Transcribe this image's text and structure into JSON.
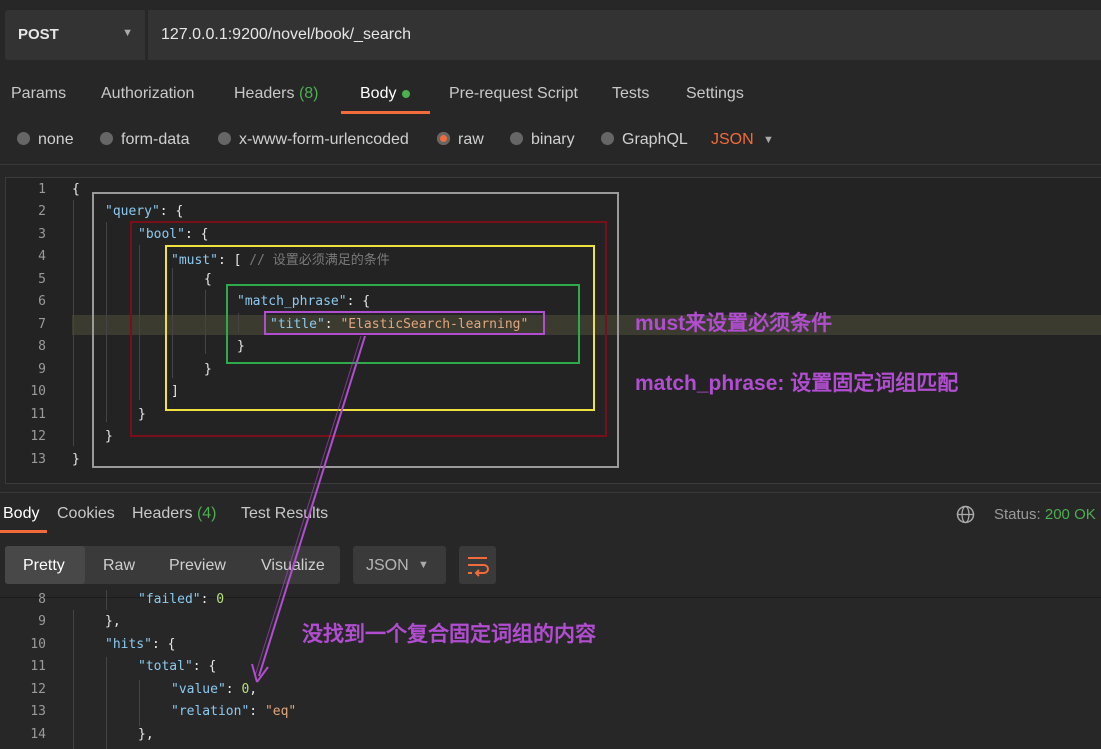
{
  "request": {
    "method": "POST",
    "url": "127.0.0.1:9200/novel/book/_search"
  },
  "request_tabs": [
    {
      "label": "Params"
    },
    {
      "label": "Authorization"
    },
    {
      "label": "Headers",
      "count": "(8)"
    },
    {
      "label": "Body"
    },
    {
      "label": "Pre-request Script"
    },
    {
      "label": "Tests"
    },
    {
      "label": "Settings"
    }
  ],
  "body_types": [
    "none",
    "form-data",
    "x-www-form-urlencoded",
    "raw",
    "binary",
    "GraphQL"
  ],
  "body_language": "JSON",
  "editor": {
    "line_numbers": [
      "1",
      "2",
      "3",
      "4",
      "5",
      "6",
      "7",
      "8",
      "9",
      "10",
      "11",
      "12",
      "13"
    ],
    "lines": [
      "{",
      "  \"query\": {",
      "    \"bool\": {",
      "      \"must\": [ // 设置必须满足的条件",
      "        {",
      "          \"match_phrase\": {",
      "            \"title\": \"ElasticSearch-learning\"",
      "          }",
      "        }",
      "      ]",
      "    }",
      "  }",
      "}"
    ],
    "tokens": {
      "query": "\"query\"",
      "bool": "\"bool\"",
      "must": "\"must\"",
      "comment": "// 设置必须满足的条件",
      "match_phrase": "\"match_phrase\"",
      "title_key": "\"title\"",
      "title_val": "\"ElasticSearch-learning\""
    }
  },
  "annotations": {
    "must": "must来设置必须条件",
    "match_phrase": "match_phrase: 设置固定词组匹配",
    "no_result": "没找到一个复合固定词组的内容"
  },
  "response_tabs": [
    {
      "label": "Body"
    },
    {
      "label": "Cookies"
    },
    {
      "label": "Headers",
      "count": "(4)"
    },
    {
      "label": "Test Results"
    }
  ],
  "status": {
    "label": "Status:",
    "value": "200 OK"
  },
  "view_modes": [
    "Pretty",
    "Raw",
    "Preview",
    "Visualize"
  ],
  "response_format": "JSON",
  "response": {
    "line_numbers": [
      "8",
      "9",
      "10",
      "11",
      "12",
      "13",
      "14"
    ],
    "tokens": {
      "failed_key": "\"failed\"",
      "failed_val": "0",
      "hits_key": "\"hits\"",
      "total_key": "\"total\"",
      "value_key": "\"value\"",
      "value_val": "0",
      "relation_key": "\"relation\"",
      "relation_val": "\"eq\""
    }
  },
  "colors": {
    "accent": "#f26b3a",
    "success": "#4caf50",
    "annotation": "#b14dd0",
    "box_outer": "#9a9a9a",
    "box_bool": "#7a0f1c",
    "box_must": "#f0e040",
    "box_phrase": "#2eaa4a",
    "box_title": "#b14dd0"
  }
}
